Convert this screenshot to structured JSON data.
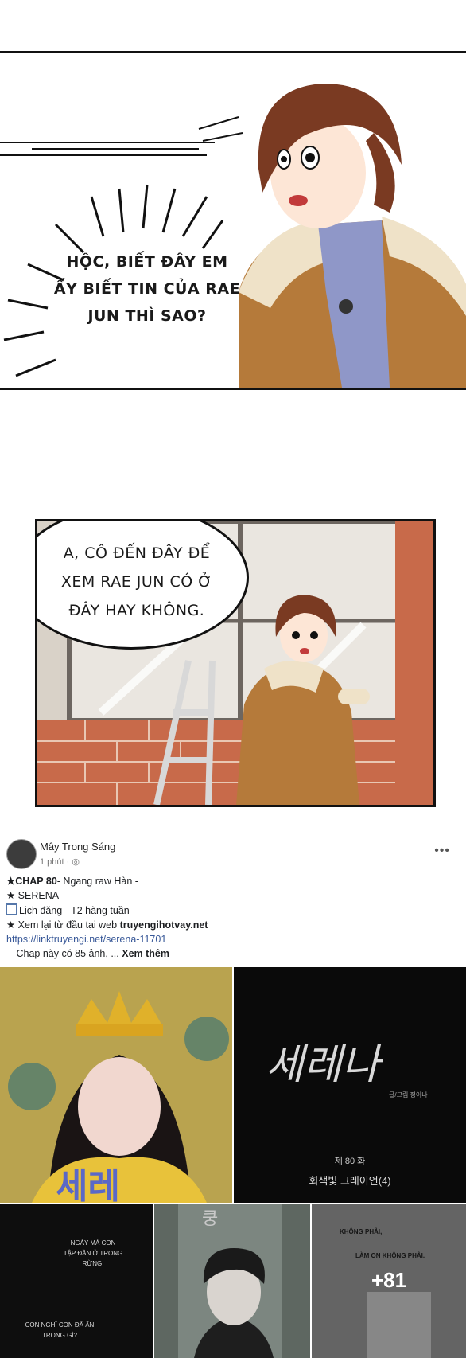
{
  "panel1": {
    "speech": [
      "HỘC, BIẾT ĐÂY EM",
      "ẤY BIẾT TIN CỦA RAE",
      "JUN THÌ SAO?"
    ]
  },
  "panel2": {
    "speech": [
      "A, CÔ ĐẾN ĐÂY ĐỂ",
      "XEM RAE JUN CÓ Ở",
      "ĐÂY HAY KHÔNG."
    ]
  },
  "post": {
    "author": "Mây Trong Sáng",
    "time": "1 phút ·",
    "more_icon": "more-dots-icon",
    "lines": {
      "l1_bold": "★CHAP 80",
      "l1_rest": "- Ngang raw Hàn -",
      "l2": "★ SERENA",
      "l3": "Lịch đăng - T2 hàng tuần",
      "l4_pre": "★ Xem lại từ đầu tại web ",
      "l4_bold": "truyengihotvay.net",
      "link": "https://linktruyengi.net/serena-11701",
      "l6": "---Chap này có 85 ảnh, ...",
      "see_more": "Xem thêm"
    }
  },
  "gallery": {
    "title_korean": "세레나",
    "credit_small": "글/그림 정이나",
    "episode": "제 80 화",
    "episode_title": "회색빛 그레이언(4)",
    "bubble_a": [
      "NGÀY MÀ CON",
      "TẬP ĐẦN Ở TRONG",
      "RỪNG."
    ],
    "bubble_b": [
      "CON NGHĨ CON ĐÃ ẨN",
      "TRONG GÌ?"
    ],
    "mini_a": "KHÔNG PHẢI,",
    "mini_b": "LÀM ON KHÔNG PHẢI.",
    "more_count": "+81",
    "sfx": "쿵"
  },
  "colors": {
    "coat": "#b57a3a",
    "hair": "#7a3a22",
    "link": "#385898",
    "brick": "#c86a4a"
  }
}
